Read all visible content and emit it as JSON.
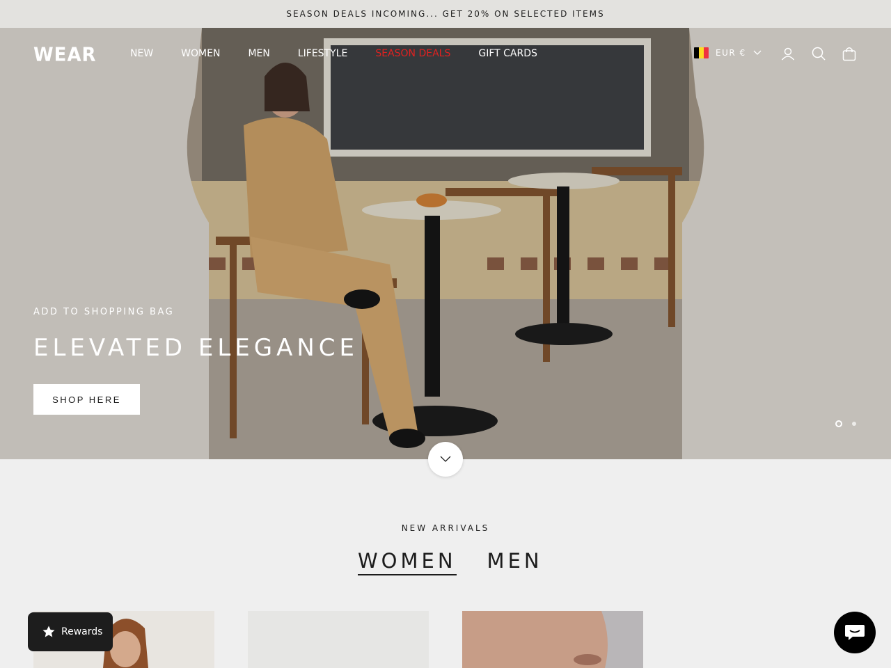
{
  "announcement": {
    "text": "SEASON DEALS INCOMING... GET 20% ON SELECTED ITEMS"
  },
  "header": {
    "logo": "WEAR",
    "nav": [
      {
        "label": "NEW"
      },
      {
        "label": "WOMEN"
      },
      {
        "label": "MEN"
      },
      {
        "label": "LIFESTYLE"
      },
      {
        "label": "SEASON DEALS",
        "highlight": "#e22120"
      },
      {
        "label": "GIFT CARDS"
      }
    ],
    "locale": {
      "currency": "EUR €",
      "flag": "belgium-flag"
    },
    "icons": [
      "account-icon",
      "search-icon",
      "bag-icon"
    ]
  },
  "hero": {
    "subheading": "ADD TO SHOPPING BAG",
    "title": "ELEVATED ELEGANCE",
    "button": "SHOP HERE",
    "slides_total": 2,
    "slide_active": 1
  },
  "arrivals": {
    "label": "NEW ARRIVALS",
    "tabs": [
      {
        "label": "WOMEN",
        "active": true
      },
      {
        "label": "MEN",
        "active": false
      }
    ]
  },
  "widgets": {
    "rewards_label": "Rewards",
    "chat_icon": "chat-icon"
  },
  "colors": {
    "announcement_bg": "#e3e2df",
    "sale_red": "#e22120",
    "page_bg": "#efefef",
    "dark": "#1d1d1d"
  }
}
